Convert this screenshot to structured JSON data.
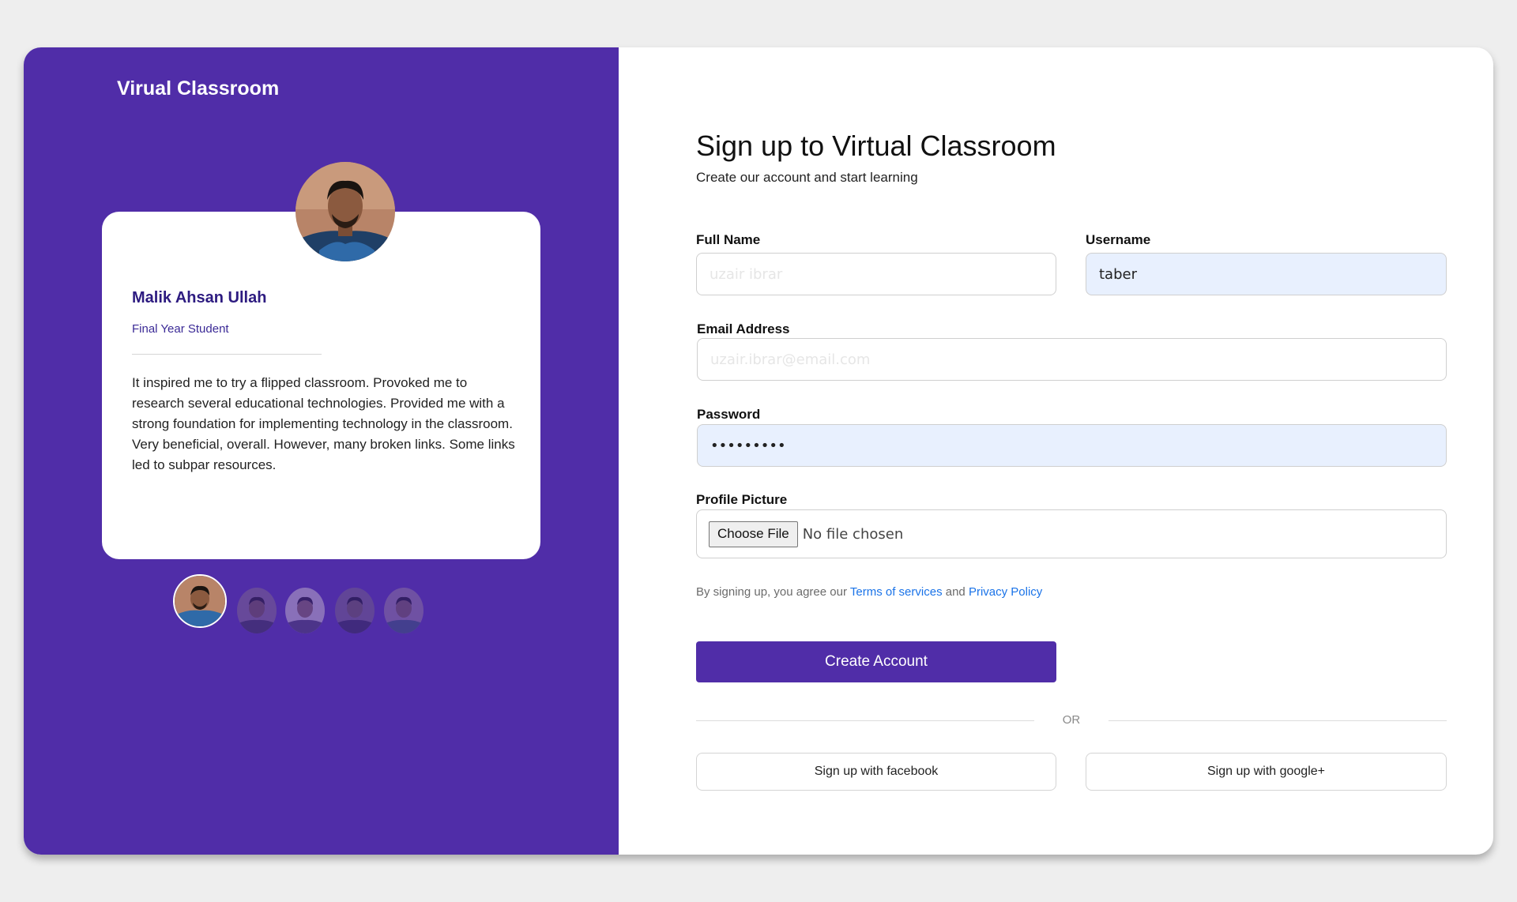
{
  "brand": {
    "name": "Virual Classroom"
  },
  "testimonial": {
    "name": "Malik Ahsan Ullah",
    "role": "Final Year Student",
    "quote": "It inspired me to try a flipped classroom. Provoked me to research several educational technologies. Provided me with a strong foundation for implementing technology in the classroom. Very beneficial, overall. However, many broken links. Some links led to subpar resources.",
    "active_index": 0,
    "total_slides": 5
  },
  "form": {
    "title": "Sign up to Virtual Classroom",
    "subtitle": "Create our account and start learning",
    "full_name": {
      "label": "Full Name",
      "placeholder": "uzair ibrar",
      "value": ""
    },
    "username": {
      "label": "Username",
      "placeholder": "",
      "value": "taber"
    },
    "email": {
      "label": "Email Address",
      "placeholder": "uzair.ibrar@email.com",
      "value": ""
    },
    "password": {
      "label": "Password",
      "value": "•••••••••"
    },
    "profile_picture": {
      "label": "Profile Picture",
      "button": "Choose File",
      "status": "No file chosen"
    },
    "terms": {
      "prefix": "By signing up, you agree our",
      "tos_link": "Terms of services",
      "conjunction": "and",
      "privacy_link": "Privacy Policy"
    },
    "submit": "Create Account",
    "divider": "OR",
    "facebook": "Sign up with facebook",
    "google": "Sign up with google+"
  },
  "colors": {
    "brand_purple": "#502da8",
    "link_blue": "#1a73e8",
    "autofill_bg": "#e8f0fe"
  }
}
